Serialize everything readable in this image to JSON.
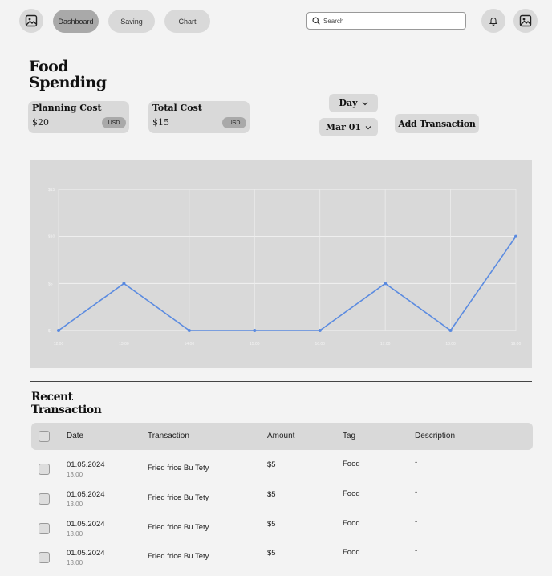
{
  "nav": {
    "tabs": [
      {
        "label": "Dashboard",
        "active": true
      },
      {
        "label": "Saving",
        "active": false
      },
      {
        "label": "Chart",
        "active": false
      }
    ],
    "search_placeholder": "Search",
    "icons": [
      "image-icon",
      "bell-icon",
      "image-icon"
    ]
  },
  "page": {
    "title": "Food Spending"
  },
  "summary": {
    "planning": {
      "label": "Planning Cost",
      "value": "$20",
      "currency": "USD"
    },
    "total": {
      "label": "Total Cost",
      "value": "$15",
      "currency": "USD"
    }
  },
  "controls": {
    "period": "Day",
    "date": "Mar 01",
    "add_label": "Add Transaction"
  },
  "chart_data": {
    "type": "line",
    "x": [
      "12:00",
      "13:00",
      "14:00",
      "15:00",
      "16:00",
      "17:00",
      "18:00",
      "19:00"
    ],
    "series": [
      {
        "values": [
          0,
          5,
          0,
          0,
          0,
          5,
          0,
          10
        ]
      }
    ],
    "ytick_labels": [
      "$15",
      "$10",
      "$5",
      "$"
    ],
    "ylim": [
      0,
      15
    ],
    "grid": true,
    "line_color": "#5b8be0"
  },
  "recent": {
    "title": "Recent Transaction",
    "columns": [
      "Date",
      "Transaction",
      "Amount",
      "Tag",
      "Description"
    ],
    "rows": [
      {
        "date": "01.05.2024",
        "time": "13.00",
        "transaction": "Fried frice Bu Tety",
        "amount": "$5",
        "tag": "Food",
        "description": "-"
      },
      {
        "date": "01.05.2024",
        "time": "13.00",
        "transaction": "Fried frice Bu Tety",
        "amount": "$5",
        "tag": "Food",
        "description": "-"
      },
      {
        "date": "01.05.2024",
        "time": "13.00",
        "transaction": "Fried frice Bu Tety",
        "amount": "$5",
        "tag": "Food",
        "description": "-"
      },
      {
        "date": "01.05.2024",
        "time": "13.00",
        "transaction": "Fried frice Bu Tety",
        "amount": "$5",
        "tag": "Food",
        "description": "-"
      }
    ]
  }
}
